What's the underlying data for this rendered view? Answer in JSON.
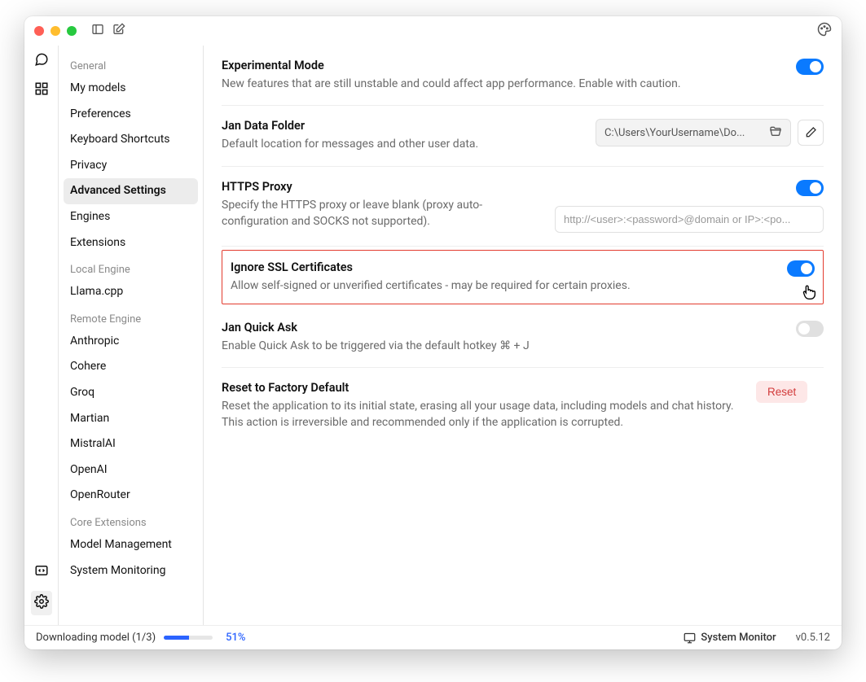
{
  "titlebar": {},
  "sidebar": {
    "sections": {
      "general": {
        "head": "General",
        "items": [
          "My models",
          "Preferences",
          "Keyboard Shortcuts",
          "Privacy",
          "Advanced Settings",
          "Engines",
          "Extensions"
        ]
      },
      "local": {
        "head": "Local Engine",
        "items": [
          "Llama.cpp"
        ]
      },
      "remote": {
        "head": "Remote Engine",
        "items": [
          "Anthropic",
          "Cohere",
          "Groq",
          "Martian",
          "MistralAI",
          "OpenAI",
          "OpenRouter"
        ]
      },
      "core": {
        "head": "Core Extensions",
        "items": [
          "Model Management",
          "System Monitoring"
        ]
      }
    },
    "active": "Advanced Settings"
  },
  "settings": {
    "experimental": {
      "title": "Experimental Mode",
      "desc": "New features that are still unstable and could affect app performance. Enable with caution."
    },
    "datafolder": {
      "title": "Jan Data Folder",
      "desc": "Default location for messages and other user data.",
      "path": "C:\\Users\\YourUsername\\Do..."
    },
    "proxy": {
      "title": "HTTPS Proxy",
      "desc": "Specify the HTTPS proxy or leave blank (proxy auto-configuration and SOCKS not supported).",
      "placeholder": "http://<user>:<password>@domain or IP>:<po..."
    },
    "ssl": {
      "title": "Ignore SSL Certificates",
      "desc": "Allow self-signed or unverified certificates - may be required for certain proxies."
    },
    "quickask": {
      "title": "Jan Quick Ask",
      "desc": "Enable Quick Ask to be triggered via the default hotkey ⌘ + J"
    },
    "reset": {
      "title": "Reset to Factory Default",
      "desc": "Reset the application to its initial state, erasing all your usage data, including models and chat history. This action is irreversible and recommended only if the application is corrupted.",
      "button": "Reset"
    }
  },
  "status": {
    "downloading": "Downloading model (1/3)",
    "pct": "51%",
    "sysmon": "System Monitor",
    "version": "v0.5.12"
  }
}
